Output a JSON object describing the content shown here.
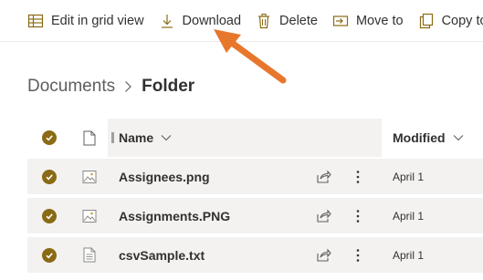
{
  "command_bar": {
    "edit_grid": "Edit in grid view",
    "download": "Download",
    "delete": "Delete",
    "move_to": "Move to",
    "copy_to": "Copy to"
  },
  "breadcrumb": {
    "root": "Documents",
    "current": "Folder"
  },
  "table": {
    "columns": {
      "name": "Name",
      "modified": "Modified"
    },
    "rows": [
      {
        "name": "Assignees.png",
        "modified": "April 1",
        "type_icon": "image-file-icon"
      },
      {
        "name": "Assignments.PNG",
        "modified": "April 1",
        "type_icon": "image-file-icon"
      },
      {
        "name": "csvSample.txt",
        "modified": "April 1",
        "type_icon": "text-file-icon"
      }
    ]
  },
  "colors": {
    "accent_check": "#8a6a14",
    "selected_row": "#f3f2f1",
    "annotation_arrow": "#e8772e"
  }
}
